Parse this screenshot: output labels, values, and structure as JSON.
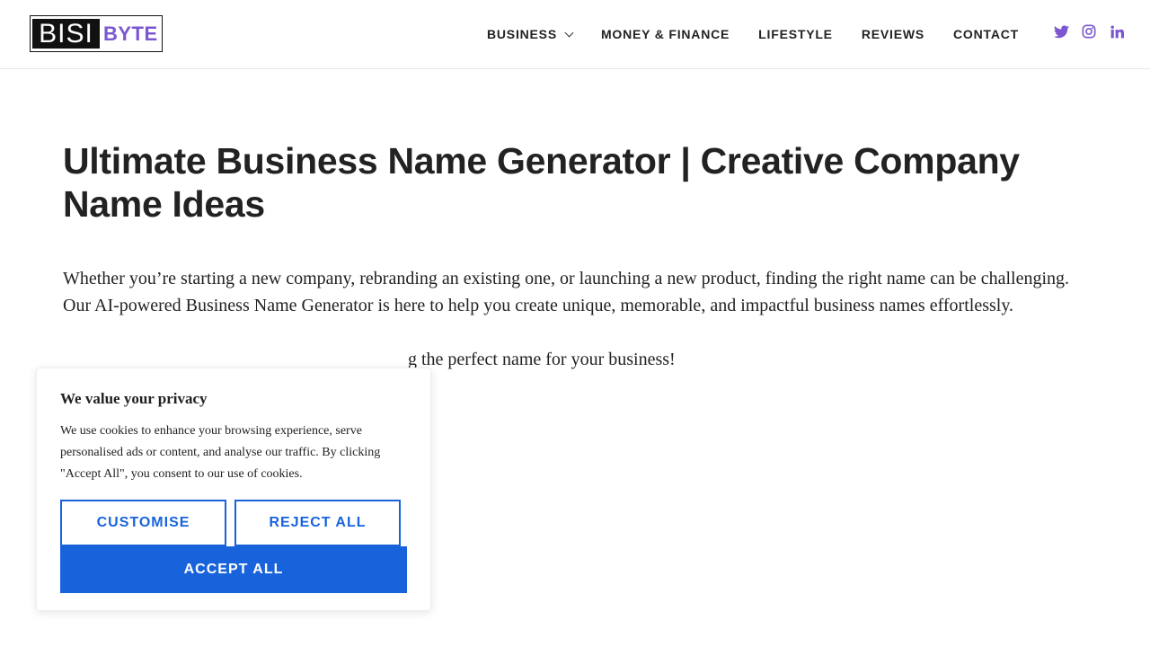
{
  "header": {
    "logo": {
      "part1": "BISI",
      "part2": "BYTE"
    },
    "nav": [
      {
        "label": "BUSINESS",
        "has_dropdown": true
      },
      {
        "label": "MONEY & FINANCE"
      },
      {
        "label": "LIFESTYLE"
      },
      {
        "label": "REVIEWS"
      },
      {
        "label": "CONTACT"
      }
    ],
    "social": [
      "twitter-icon",
      "instagram-icon",
      "linkedin-icon"
    ],
    "social_color": "#7b57d1"
  },
  "article": {
    "title": "Ultimate Business Name Generator | Creative Company Name Ideas",
    "paragraph1": "Whether you’re starting a new company, rebranding an existing one, or launching a new product, finding the right name can be challenging. Our AI-powered Business Name Generator is here to help you create unique, memorable, and impactful business names effortlessly.",
    "paragraph2_visible": "g the perfect name for your business!"
  },
  "cookie_banner": {
    "title": "We value your privacy",
    "text": "We use cookies to enhance your browsing experience, serve personalised ads or content, and analyse our traffic. By clicking \"Accept All\", you consent to our use of cookies.",
    "customise_label": "CUSTOMISE",
    "reject_label": "REJECT ALL",
    "accept_label": "ACCEPT ALL",
    "accent_color": "#1863dc"
  }
}
